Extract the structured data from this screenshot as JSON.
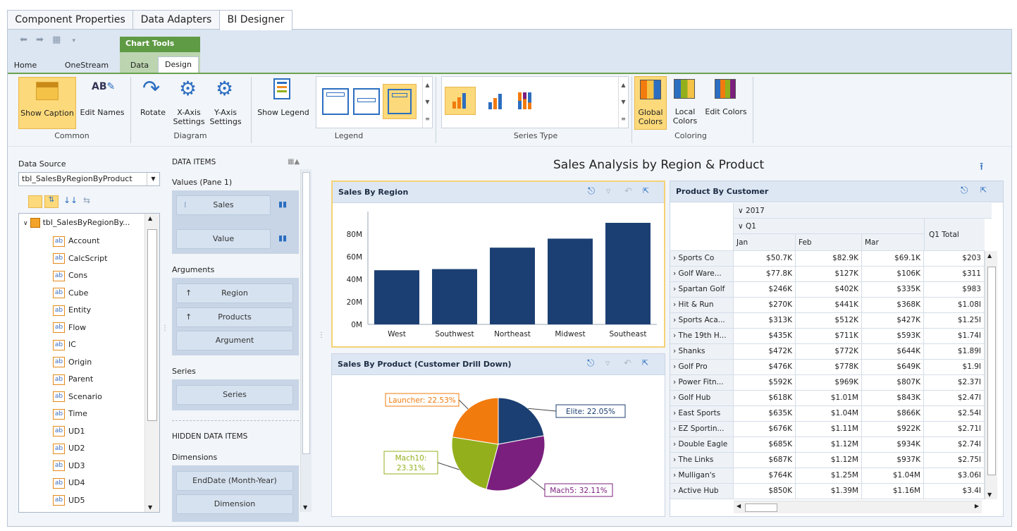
{
  "top_tabs": [
    "Component Properties",
    "Data Adapters",
    "BI Designer"
  ],
  "context_tab": "Chart Tools",
  "ribbon_tabs": [
    "Home",
    "OneStream",
    "Data",
    "Design"
  ],
  "ribbon": {
    "show_caption": "Show Caption",
    "edit_names": "Edit Names",
    "common": "Common",
    "rotate": "Rotate",
    "x_axis_settings": "X-Axis Settings",
    "x_axis_l1": "X-Axis",
    "x_axis_l2": "Settings",
    "y_axis_l1": "Y-Axis",
    "y_axis_l2": "Settings",
    "diagram": "Diagram",
    "show_legend": "Show Legend",
    "legend": "Legend",
    "series_type": "Series Type",
    "global_l1": "Global",
    "global_l2": "Colors",
    "local_l1": "Local",
    "local_l2": "Colors",
    "edit_colors": "Edit Colors",
    "coloring": "Coloring"
  },
  "data_source": {
    "label": "Data Source",
    "value": "tbl_SalesByRegionByProduct",
    "root": "tbl_SalesByRegionBy...",
    "fields": [
      "Account",
      "CalcScript",
      "Cons",
      "Cube",
      "Entity",
      "Flow",
      "IC",
      "Origin",
      "Parent",
      "Scenario",
      "Time",
      "UD1",
      "UD2",
      "UD3",
      "UD4",
      "UD5"
    ],
    "field_badge": "ab"
  },
  "data_items": {
    "header": "DATA ITEMS",
    "values_title": "Values (Pane 1)",
    "sales": "Sales",
    "value": "Value",
    "arguments_title": "Arguments",
    "region": "Region",
    "products": "Products",
    "argument": "Argument",
    "series_title": "Series",
    "series": "Series",
    "hidden_header": "HIDDEN DATA ITEMS",
    "dimensions_title": "Dimensions",
    "enddate": "EndDate (Month-Year)",
    "dimension": "Dimension"
  },
  "dashboard_title": "Sales Analysis by Region & Product",
  "bar_chart": {
    "caption": "Sales By Region",
    "chart_data": {
      "type": "bar",
      "categories": [
        "West",
        "Southwest",
        "Northeast",
        "Midwest",
        "Southeast"
      ],
      "values": [
        48,
        49,
        68,
        76,
        90
      ],
      "ylim": [
        0,
        100
      ],
      "yticks": [
        "0M",
        "20M",
        "40M",
        "60M",
        "80M"
      ],
      "ytick_values": [
        0,
        20,
        40,
        60,
        80
      ],
      "color": "#1b3f72"
    }
  },
  "pie_chart": {
    "caption": "Sales By Product (Customer Drill Down)",
    "chart_data": {
      "type": "pie",
      "slices": [
        {
          "label": "Elite: 22.05%",
          "value": 22.05,
          "color": "#1b3f72"
        },
        {
          "label": "Mach5: 32.11%",
          "value": 32.11,
          "color": "#7b1f7e"
        },
        {
          "label_l1": "Mach10:",
          "label_l2": "23.31%",
          "value": 23.31,
          "color": "#93b01c"
        },
        {
          "label": "Launcher: 22.53%",
          "value": 22.53,
          "color": "#f27b0e"
        }
      ]
    }
  },
  "pivot": {
    "caption": "Product By Customer",
    "year": "2017",
    "quarter": "Q1",
    "q_total": "Q1 Total",
    "months": [
      "Jan",
      "Feb",
      "Mar"
    ],
    "rows": [
      {
        "name": "Sports Co",
        "jan": "$50.7K",
        "feb": "$82.9K",
        "mar": "$69.1K",
        "tot": "$203"
      },
      {
        "name": "Golf Ware...",
        "jan": "$77.8K",
        "feb": "$127K",
        "mar": "$106K",
        "tot": "$311"
      },
      {
        "name": "Spartan Golf",
        "jan": "$246K",
        "feb": "$402K",
        "mar": "$335K",
        "tot": "$983"
      },
      {
        "name": "Hit & Run",
        "jan": "$270K",
        "feb": "$441K",
        "mar": "$368K",
        "tot": "$1.08I"
      },
      {
        "name": "Sports Aca...",
        "jan": "$313K",
        "feb": "$512K",
        "mar": "$427K",
        "tot": "$1.25I"
      },
      {
        "name": "The 19th H...",
        "jan": "$435K",
        "feb": "$711K",
        "mar": "$593K",
        "tot": "$1.74I"
      },
      {
        "name": "Shanks",
        "jan": "$472K",
        "feb": "$772K",
        "mar": "$644K",
        "tot": "$1.89I"
      },
      {
        "name": "Golf Pro",
        "jan": "$476K",
        "feb": "$778K",
        "mar": "$649K",
        "tot": "$1.9I"
      },
      {
        "name": "Power Fitn...",
        "jan": "$592K",
        "feb": "$969K",
        "mar": "$807K",
        "tot": "$2.37I"
      },
      {
        "name": "Golf Hub",
        "jan": "$618K",
        "feb": "$1.01M",
        "mar": "$843K",
        "tot": "$2.47I"
      },
      {
        "name": "East Sports",
        "jan": "$635K",
        "feb": "$1.04M",
        "mar": "$866K",
        "tot": "$2.54I"
      },
      {
        "name": "EZ Sportin...",
        "jan": "$676K",
        "feb": "$1.11M",
        "mar": "$922K",
        "tot": "$2.71I"
      },
      {
        "name": "Double Eagle",
        "jan": "$685K",
        "feb": "$1.12M",
        "mar": "$934K",
        "tot": "$2.74I"
      },
      {
        "name": "The Links",
        "jan": "$687K",
        "feb": "$1.12M",
        "mar": "$937K",
        "tot": "$2.75I"
      },
      {
        "name": "Mulligan's",
        "jan": "$764K",
        "feb": "$1.25M",
        "mar": "$1.04M",
        "tot": "$3.06I"
      },
      {
        "name": "Active Hub",
        "jan": "$850K",
        "feb": "$1.39M",
        "mar": "$1.16M",
        "tot": "$3.4I"
      }
    ]
  }
}
